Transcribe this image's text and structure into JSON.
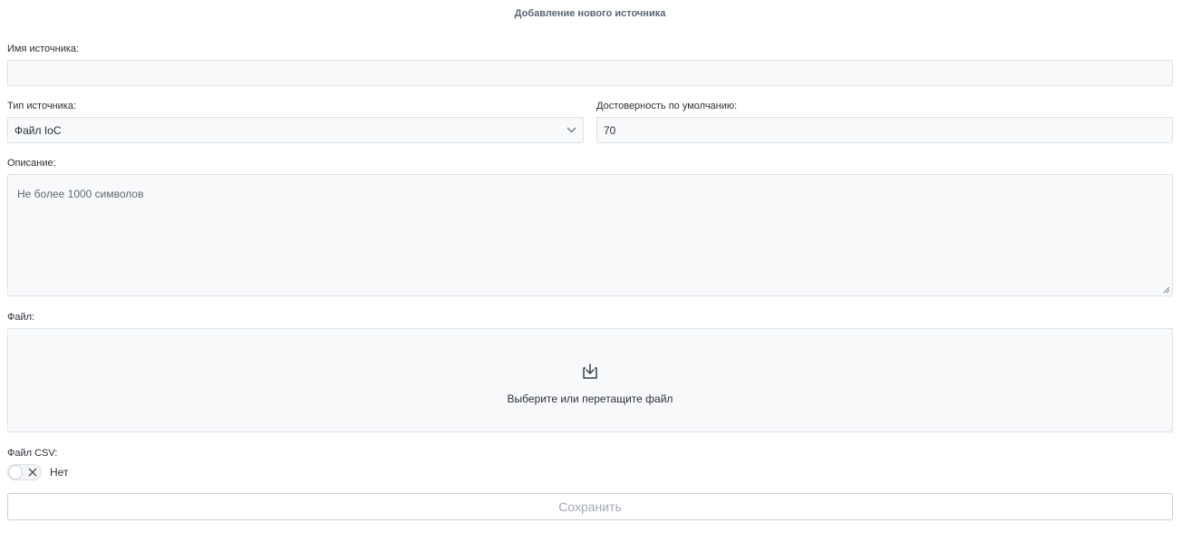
{
  "form": {
    "title": "Добавление нового источника",
    "name_label": "Имя источника:",
    "name_value": "",
    "type_label": "Тип источника:",
    "type_value": "Файл IoC",
    "reliability_label": "Достоверность по умолчанию:",
    "reliability_value": "70",
    "description_label": "Описание:",
    "description_placeholder": "Не более 1000 символов",
    "file_label": "Файл:",
    "file_drop_text": "Выберите или перетащите файл",
    "csv_label": "Файл CSV:",
    "csv_toggle_text": "Нет",
    "csv_toggle_on": false,
    "save_label": "Сохранить",
    "save_enabled": false
  },
  "icons": {
    "select": "chevron-down-icon",
    "upload": "download-tray-icon",
    "toggle_off": "close-icon"
  }
}
